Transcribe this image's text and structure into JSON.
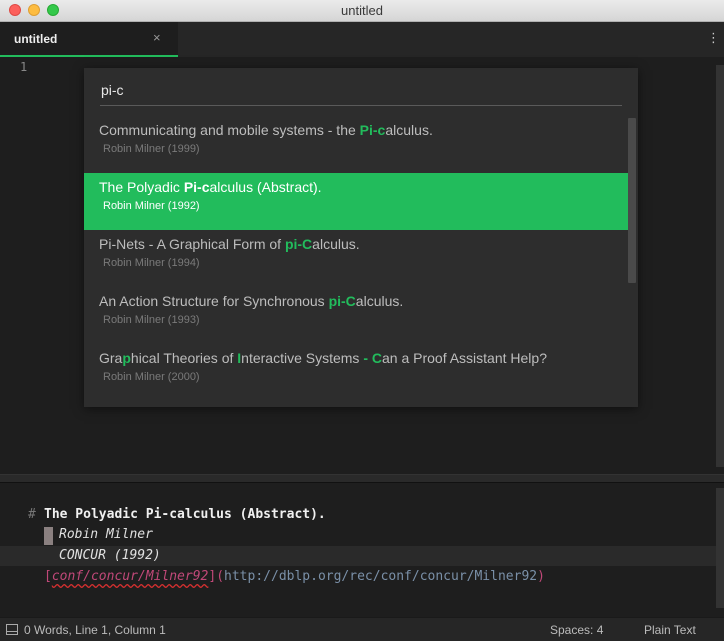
{
  "window": {
    "title": "untitled"
  },
  "tab": {
    "label": "untitled",
    "close": "×",
    "menu": "⋮"
  },
  "editor_top": {
    "line_number": "1"
  },
  "quick_panel": {
    "query": "pi-c",
    "items": [
      {
        "title_parts": [
          [
            "Communicating and mobile systems - the ",
            false
          ],
          [
            "Pi-c",
            true
          ],
          [
            "alculus.",
            false
          ]
        ],
        "subtitle": "Robin Milner (1999)"
      },
      {
        "title_parts": [
          [
            "The Polyadic ",
            false
          ],
          [
            "Pi-c",
            true
          ],
          [
            "alculus (Abstract).",
            false
          ]
        ],
        "subtitle": "Robin Milner (1992)",
        "selected": true
      },
      {
        "title_parts": [
          [
            "Pi-Nets - A Graphical Form of ",
            false
          ],
          [
            "pi-C",
            true
          ],
          [
            "alculus.",
            false
          ]
        ],
        "subtitle": "Robin Milner (1994)"
      },
      {
        "title_parts": [
          [
            "An Action Structure for Synchronous ",
            false
          ],
          [
            "pi-C",
            true
          ],
          [
            "alculus.",
            false
          ]
        ],
        "subtitle": "Robin Milner (1993)"
      },
      {
        "title_parts": [
          [
            "Gra",
            false
          ],
          [
            "p",
            true
          ],
          [
            "hical Theories of ",
            false
          ],
          [
            "I",
            true
          ],
          [
            "nteractive Systems ",
            false
          ],
          [
            "-",
            true
          ],
          [
            " ",
            false
          ],
          [
            "C",
            true
          ],
          [
            "an a Proof Assistant Help?",
            false
          ]
        ],
        "subtitle": "Robin Milner (2000)"
      }
    ]
  },
  "editor_bottom": {
    "hash": "#",
    "title": "The Polyadic Pi-calculus (Abstract).",
    "author": "Robin Milner",
    "venue": "CONCUR (1992)",
    "link_open": "[",
    "link_text": "conf/concur/Milner92",
    "link_mid": "](",
    "link_url": "http://dblp.org/rec/conf/concur/Milner92",
    "link_close": ")"
  },
  "status": {
    "position": "0 Words, Line 1, Column 1",
    "spaces": "Spaces: 4",
    "syntax": "Plain Text"
  },
  "colors": {
    "accent": "#22bc5c",
    "link": "#c04878",
    "url": "#7a90a8"
  }
}
